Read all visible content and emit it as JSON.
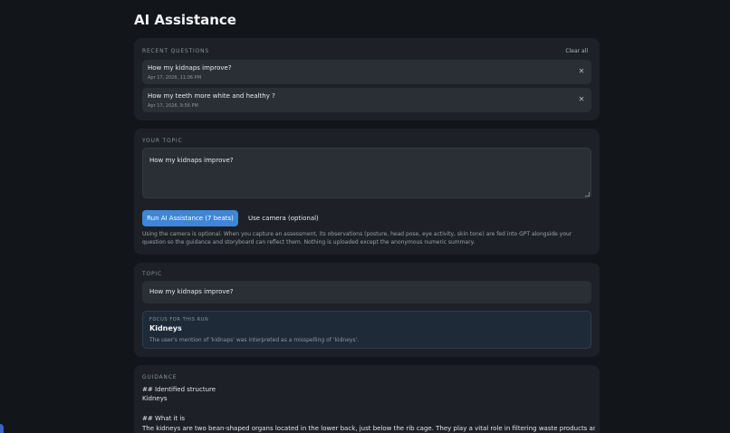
{
  "page": {
    "title": "AI Assistance"
  },
  "recent": {
    "label": "RECENT QUESTIONS",
    "clear_label": "Clear all",
    "items": [
      {
        "question": "How my kidnaps improve?",
        "time": "Apr 17, 2026, 11:06 PM",
        "close_glyph": "✕"
      },
      {
        "question": "How my teeth more white and healthy ?",
        "time": "Apr 17, 2026, 9:56 PM",
        "close_glyph": "✕"
      }
    ]
  },
  "your_topic": {
    "label": "YOUR TOPIC",
    "value": "How my kidnaps improve?",
    "run_label": "Run AI Assistance (7 beats)",
    "camera_label": "Use camera (optional)",
    "camera_note": "Using the camera is optional. When you capture an assessment, its observations (posture, head pose, eye activity, skin tone) are fed into GPT alongside your question so the guidance and storyboard can reflect them. Nothing is uploaded except the anonymous numeric summary."
  },
  "topic": {
    "label": "TOPIC",
    "value": "How my kidnaps improve?",
    "focus_label": "FOCUS FOR THIS RUN",
    "focus_title": "Kidneys",
    "focus_note": "The user's mention of 'kidnaps' was interpreted as a misspelling of 'kidneys'."
  },
  "guidance": {
    "label": "GUIDANCE",
    "lines": [
      "## Identified structure",
      "Kidneys",
      "## What it is",
      "The kidneys are two bean-shaped organs located in the lower back, just below the rib cage. They play a vital role in filtering waste products and excess fluids from"
    ]
  },
  "colors": {
    "background": "#121519",
    "card": "#1d2127",
    "accent": "#3d86d9"
  }
}
